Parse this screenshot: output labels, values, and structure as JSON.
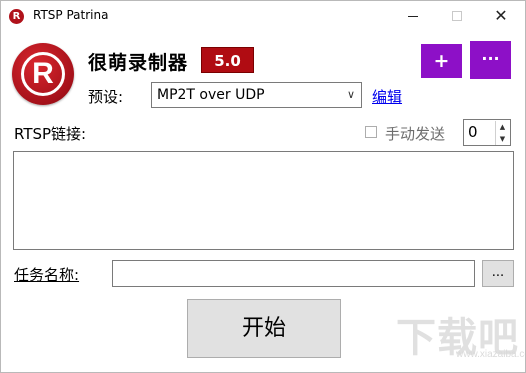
{
  "window": {
    "title": "RTSP Patrina",
    "logo_letter": "R",
    "close_glyph": "✕"
  },
  "header": {
    "app_logo_letter": "R",
    "app_name": "很萌录制器",
    "version": "5.0",
    "add_label": "+",
    "more_label": "···"
  },
  "preset": {
    "label": "预设:",
    "selected": "MP2T over UDP",
    "chevron": "∨",
    "edit_label": "编辑"
  },
  "rtsp": {
    "label": "RTSP链接:",
    "manual_send_label": "手动发送",
    "manual_send_checked": false,
    "count_value": "0",
    "up_arrow": "▲",
    "down_arrow": "▼",
    "links_text": ""
  },
  "task": {
    "label": "任务名称:",
    "value": "",
    "browse_label": "..."
  },
  "start_label": "开始",
  "watermark": {
    "text": "下载吧",
    "sub": "www.xiazaiba.com"
  },
  "colors": {
    "brand_red": "#b00c12",
    "accent_purple": "#8d10c7",
    "link_blue": "#0000ee"
  }
}
